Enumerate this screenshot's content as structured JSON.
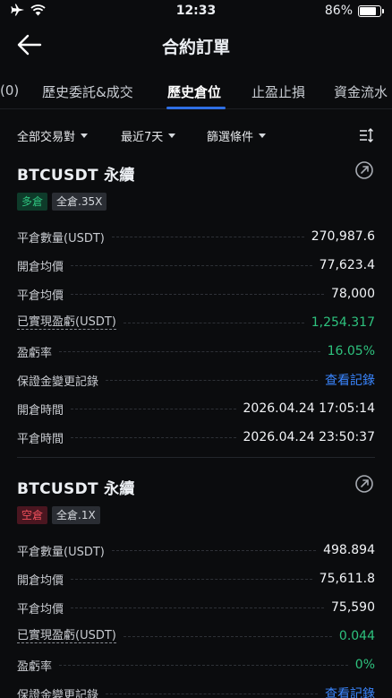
{
  "status": {
    "time": "12:33",
    "battery_percent": "86%",
    "battery_level": 0.86
  },
  "nav": {
    "title": "合約訂單",
    "back_icon": "arrow-left-icon"
  },
  "tabs": [
    {
      "label": "(0)",
      "active": false
    },
    {
      "label": "歷史委託&成交",
      "active": false
    },
    {
      "label": "歷史倉位",
      "active": true
    },
    {
      "label": "止盈止損",
      "active": false
    },
    {
      "label": "資金流水",
      "active": false
    }
  ],
  "filters": {
    "pair": "全部交易對",
    "period": "最近7天",
    "conditions": "篩選條件"
  },
  "colors": {
    "accent": "#2f6fe4",
    "green": "#2ec27e",
    "red": "#f0505c",
    "link": "#3a86ff",
    "background": "#0b0c0e"
  },
  "positions": [
    {
      "symbol": "BTCUSDT 永續",
      "side": "多倉",
      "margin_mode": "全倉.35X",
      "rows": [
        {
          "label": "平倉數量(USDT)",
          "value": "270,987.6"
        },
        {
          "label": "開倉均價",
          "value": "77,623.4"
        },
        {
          "label": "平倉均價",
          "value": "78,000"
        },
        {
          "label": "已實現盈虧(USDT)",
          "value": "1,254.317"
        },
        {
          "label": "盈虧率",
          "value": "16.05%"
        },
        {
          "label": "保證金變更記錄",
          "value": "查看記錄"
        },
        {
          "label": "開倉時間",
          "value": "2026.04.24 17:05:14"
        },
        {
          "label": "平倉時間",
          "value": "2026.04.24 23:50:37"
        }
      ]
    },
    {
      "symbol": "BTCUSDT 永續",
      "side": "空倉",
      "margin_mode": "全倉.1X",
      "rows": [
        {
          "label": "平倉數量(USDT)",
          "value": "498.894"
        },
        {
          "label": "開倉均價",
          "value": "75,611.8"
        },
        {
          "label": "平倉均價",
          "value": "75,590"
        },
        {
          "label": "已實現盈虧(USDT)",
          "value": "0.044"
        },
        {
          "label": "盈虧率",
          "value": "0%"
        },
        {
          "label": "保證金變更記錄",
          "value": "查看記錄"
        }
      ]
    }
  ]
}
